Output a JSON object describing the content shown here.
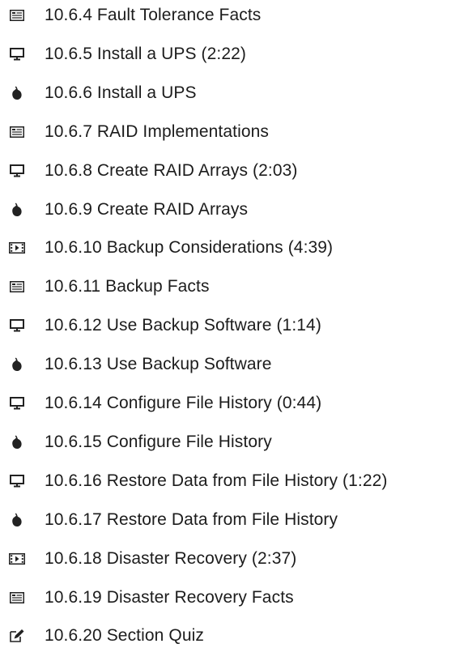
{
  "items": [
    {
      "icon": "document-icon",
      "label": "10.6.4 Fault Tolerance Facts"
    },
    {
      "icon": "monitor-icon",
      "label": "10.6.5 Install a UPS (2:22)"
    },
    {
      "icon": "mouse-icon",
      "label": "10.6.6 Install a UPS"
    },
    {
      "icon": "document-icon",
      "label": "10.6.7 RAID Implementations"
    },
    {
      "icon": "monitor-icon",
      "label": "10.6.8 Create RAID Arrays (2:03)"
    },
    {
      "icon": "mouse-icon",
      "label": "10.6.9 Create RAID Arrays"
    },
    {
      "icon": "film-icon",
      "label": "10.6.10 Backup Considerations (4:39)"
    },
    {
      "icon": "document-icon",
      "label": "10.6.11 Backup Facts"
    },
    {
      "icon": "monitor-icon",
      "label": "10.6.12 Use Backup Software (1:14)"
    },
    {
      "icon": "mouse-icon",
      "label": "10.6.13 Use Backup Software"
    },
    {
      "icon": "monitor-icon",
      "label": "10.6.14 Configure File History (0:44)"
    },
    {
      "icon": "mouse-icon",
      "label": "10.6.15 Configure File History"
    },
    {
      "icon": "monitor-icon",
      "label": "10.6.16 Restore Data from File History (1:22)"
    },
    {
      "icon": "mouse-icon",
      "label": "10.6.17 Restore Data from File History"
    },
    {
      "icon": "film-icon",
      "label": "10.6.18 Disaster Recovery (2:37)"
    },
    {
      "icon": "document-icon",
      "label": "10.6.19 Disaster Recovery Facts"
    },
    {
      "icon": "quiz-icon",
      "label": "10.6.20 Section Quiz"
    }
  ]
}
